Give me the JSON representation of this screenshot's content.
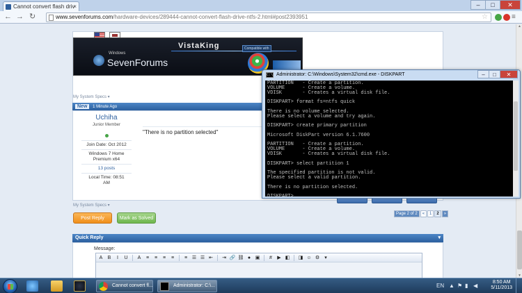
{
  "browser": {
    "tab_title": "Cannot convert flash driv",
    "tab_close": "×",
    "url_host": "www.sevenforums.com",
    "url_path": "/hardware-devices/289444-cannot-convert-flash-drive-ntfs-2.html#post2393951",
    "win_min": "–",
    "win_max": "□",
    "win_close": "✕",
    "back": "←",
    "forward": "→",
    "reload": "↻",
    "star": "☆",
    "menu": "≡"
  },
  "post1": {
    "my_system_specs": "My System Specs ▾"
  },
  "post2": {
    "badge": "New",
    "time": "1 Minute Ago",
    "username": "Uchiha",
    "user_title": "Junior Member",
    "join_date": "Join Date: Oct 2012",
    "os_line1": "Windows 7 Home",
    "os_line2": "Premium x64",
    "posts": "13 posts",
    "local_time_1": "Local Time: 08:51",
    "local_time_2": "AM",
    "message": "\"There is no partition selected\"",
    "my_system_specs": "My System Specs ▾"
  },
  "buttons": {
    "post_reply": "Post Reply",
    "mark_solved": "Mark as Solved"
  },
  "pager": {
    "label": "Page 2 of 2",
    "prev": "«",
    "p1": "1",
    "p2": "2",
    "next": "»"
  },
  "quick_reply": {
    "title": "Quick Reply",
    "collapse": "▾",
    "message_label": "Message:"
  },
  "editor_toolbar": [
    "A",
    "B",
    "I",
    "U",
    "A",
    "≡",
    "≡",
    "≡",
    "≡",
    "≡",
    "☰",
    "☰",
    "⇤",
    "⇥",
    "🔗",
    "⛓",
    "●",
    "▣",
    "#",
    "▶",
    "◧",
    "◨",
    "☺",
    "⚙",
    "▾"
  ],
  "cmd": {
    "title": "Administrator: C:\\Windows\\System32\\cmd.exe - DISKPART",
    "icon": "C:\\",
    "min": "–",
    "max": "□",
    "close": "✕",
    "lines": [
      "PARTITION   - Create a partition.",
      "VOLUME      - Create a volume.",
      "VDISK       - Creates a virtual disk file.",
      "",
      "DISKPART> format fs=ntfs quick",
      "",
      "There is no volume selected.",
      "Please select a volume and try again.",
      "",
      "DISKPART> create primary partition",
      "",
      "Microsoft DiskPart version 6.1.7600",
      "",
      "PARTITION   - Create a partition.",
      "VOLUME      - Create a volume.",
      "VDISK       - Creates a virtual disk file.",
      "",
      "DISKPART> select partition 1",
      "",
      "The specified partition is not valid.",
      "Please select a valid partition.",
      "",
      "There is no partition selected.",
      "",
      "DISKPART> "
    ]
  },
  "taskbar": {
    "chrome_task": "Cannot convert fl...",
    "cmd_task": "Administrator: C:\\...",
    "lang": "EN",
    "time": "8:50 AM",
    "date": "5/11/2013"
  },
  "colors": {
    "forum_header": "#2b5f9e",
    "reply_orange": "#f08f1b",
    "solved_green": "#6eb64d",
    "console_bg": "#000000",
    "console_fg": "#c0c0c0"
  }
}
